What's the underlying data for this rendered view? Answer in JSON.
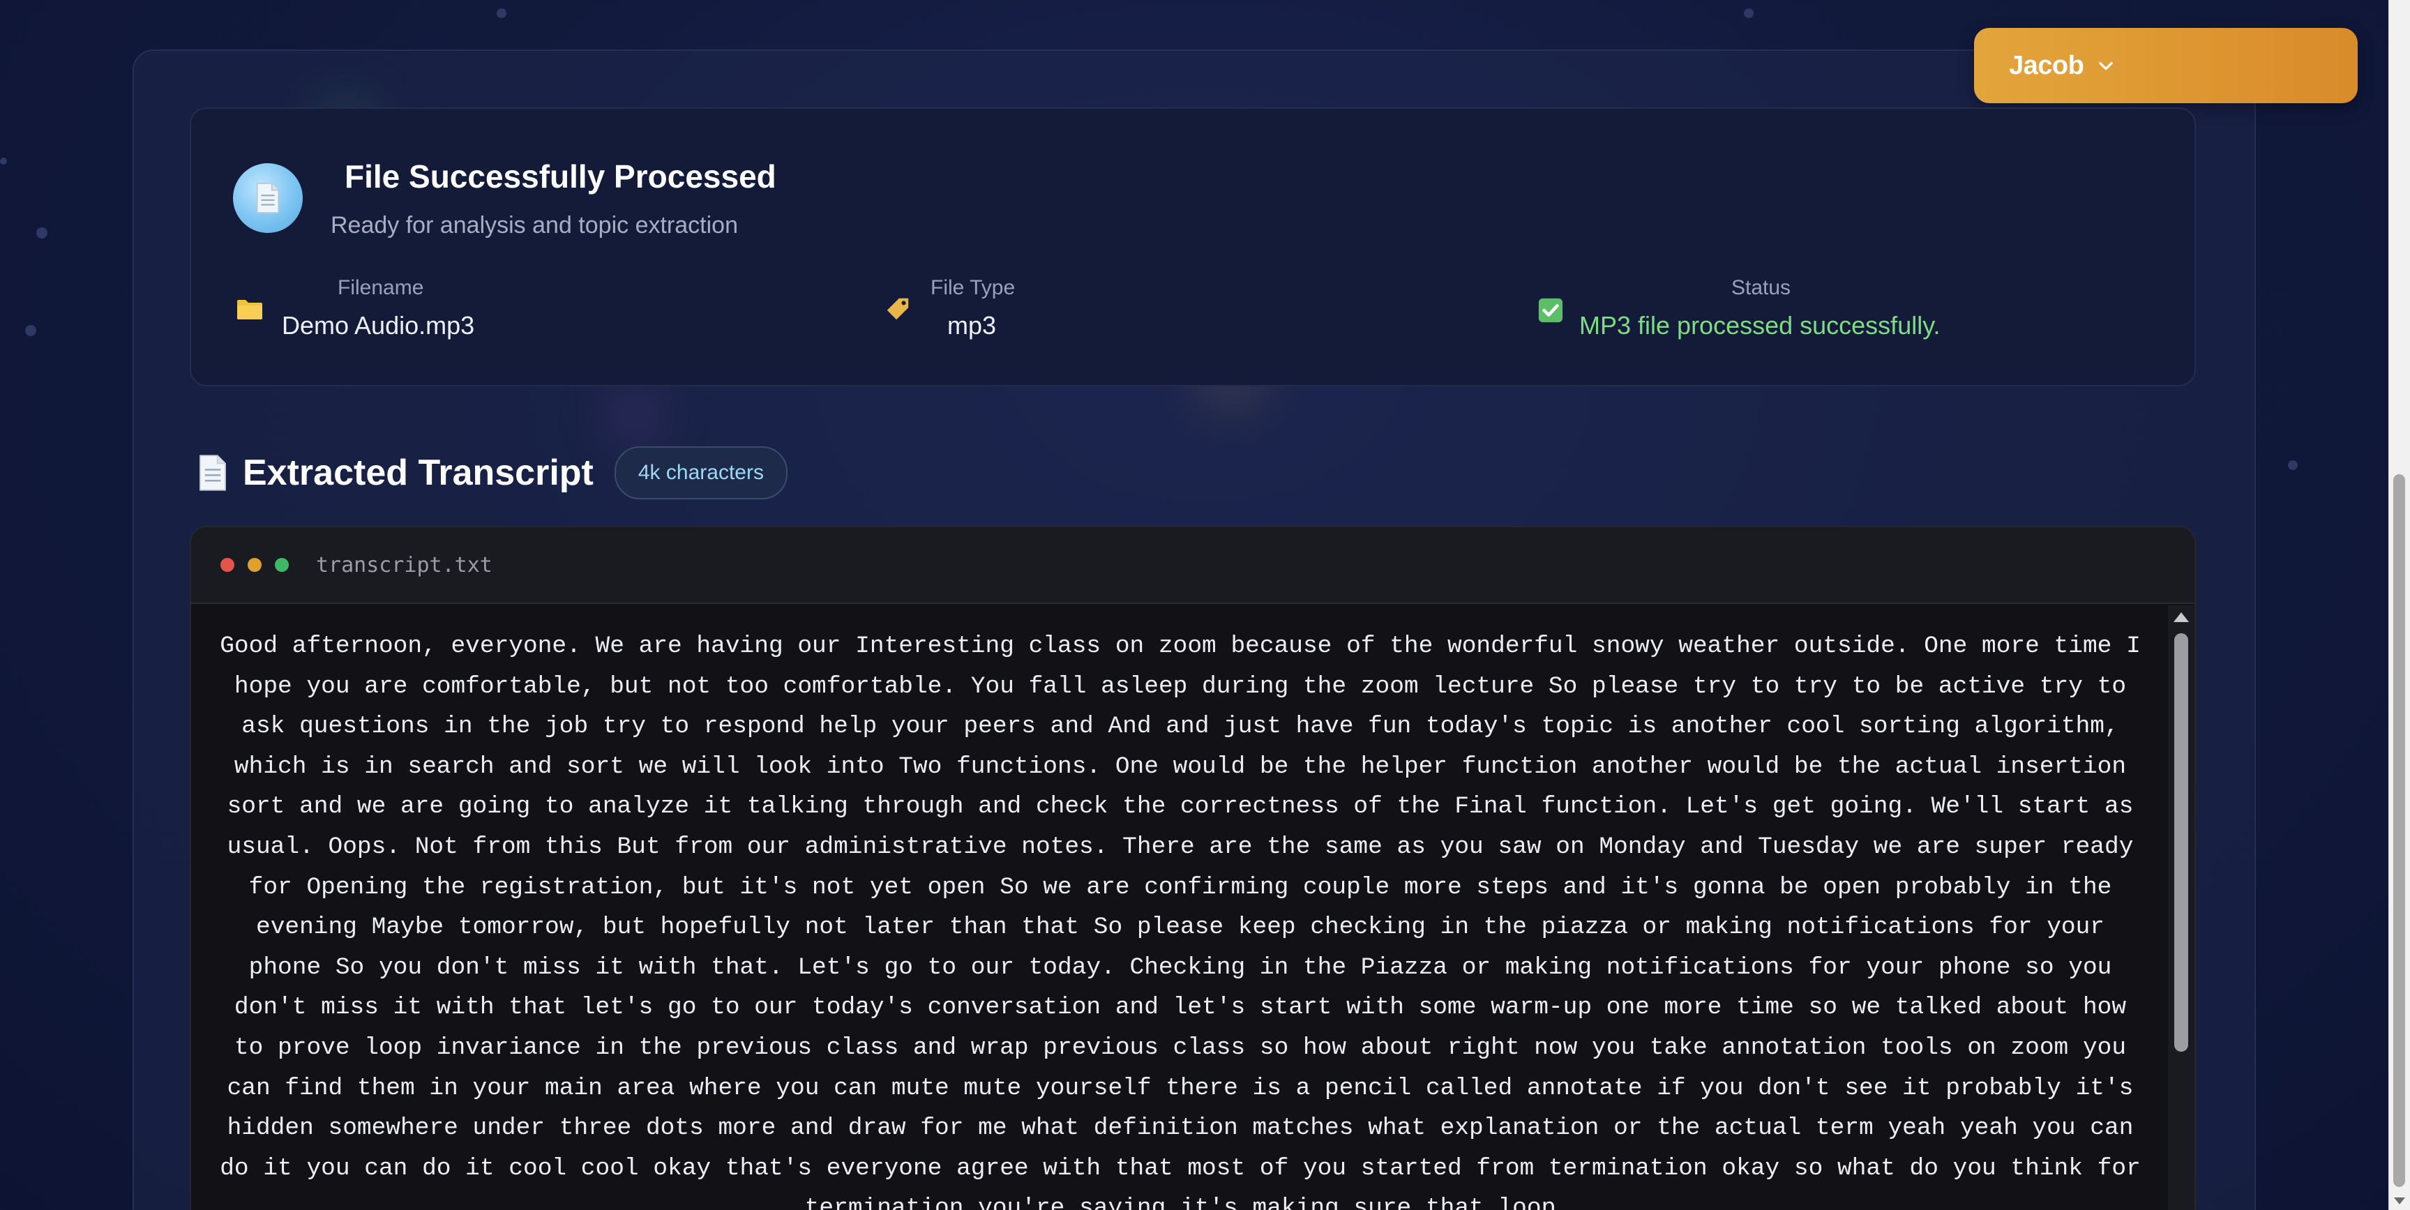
{
  "user": {
    "name": "Jacob",
    "menu_icon": "chevron-down-icon"
  },
  "file_card": {
    "icon": "document-icon",
    "title": "File Successfully Processed",
    "subtitle": "Ready for analysis and topic extraction",
    "filename": {
      "icon": "folder-icon",
      "label": "Filename",
      "value": "Demo Audio.mp3"
    },
    "file_type": {
      "icon": "tag-icon",
      "label": "File Type",
      "value": "mp3"
    },
    "status": {
      "icon": "checkbox-check-icon",
      "label": "Status",
      "value": "MP3 file processed successfully.",
      "color": "#7ddc84"
    }
  },
  "transcript_section": {
    "icon": "document-icon",
    "title": "Extracted Transcript",
    "badge": "4k characters"
  },
  "terminal": {
    "filename": "transcript.txt",
    "window_dots": [
      "#e5534b",
      "#e0a030",
      "#3fb867"
    ],
    "text": "Good afternoon, everyone. We are having our Interesting class on zoom because of the wonderful snowy weather outside. One more time I hope you are comfortable, but not too comfortable. You fall asleep during the zoom lecture So please try to try to be active try to ask questions in the job try to respond help your peers and And and just have fun today's topic is another cool sorting algorithm, which is in search and sort we will look into Two functions. One would be the helper function another would be the actual insertion sort and we are going to analyze it talking through and check the correctness of the Final function. Let's get going. We'll start as usual. Oops. Not from this But from our administrative notes. There are the same as you saw on Monday and Tuesday we are super ready for Opening the registration, but it's not yet open So we are confirming couple more steps and it's gonna be open probably in the evening Maybe tomorrow, but hopefully not later than that So please keep checking in the piazza or making notifications for your phone So you don't miss it with that. Let's go to our today. Checking in the Piazza or making notifications for your phone so you don't miss it with that let's go to our today's conversation and let's start with some warm-up one more time so we talked about how to prove loop invariance in the previous class and wrap previous class so how about right now you take annotation tools on zoom you can find them in your main area where you can mute mute yourself there is a pencil called annotate if you don't see it probably it's hidden somewhere under three dots more and draw for me what definition matches what explanation or the actual term yeah yeah you can do it you can do it cool cool okay that's everyone agree with that most of you started from termination okay so what do you think for termination you're saying it's making sure that loop"
  },
  "colors": {
    "accent_orange": "#e3a53b",
    "status_green": "#7ddc84",
    "background": "#121a3d"
  }
}
